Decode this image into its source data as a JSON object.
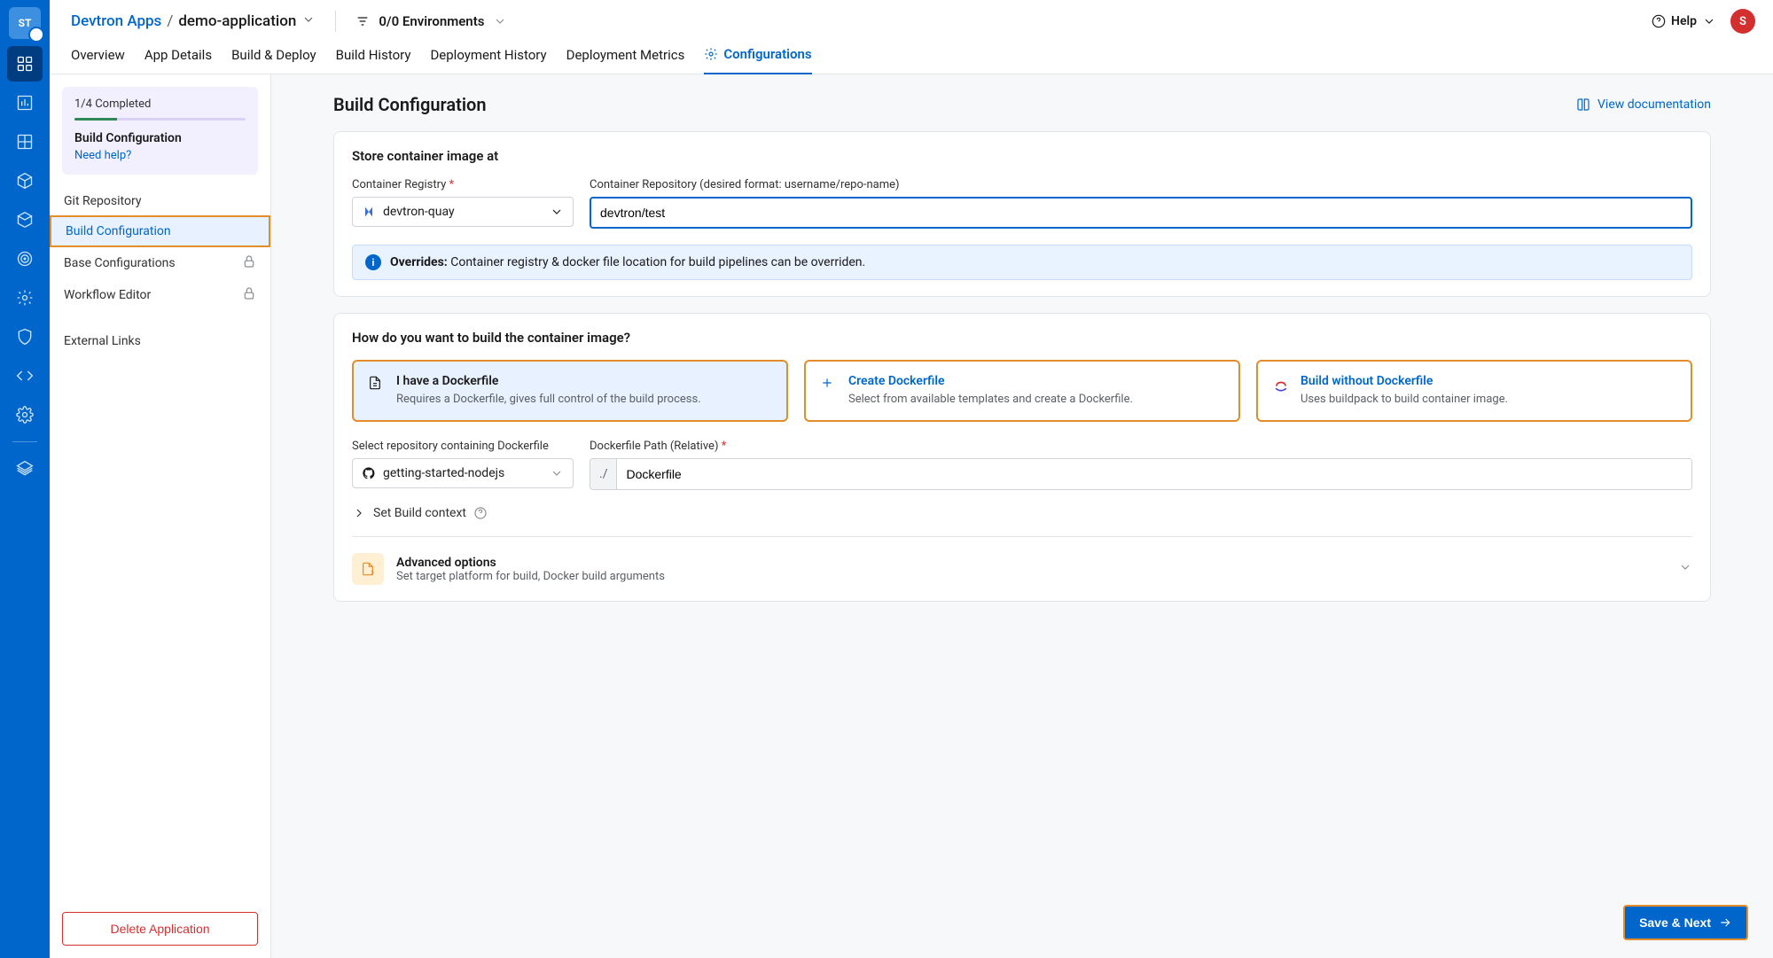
{
  "breadcrumb": {
    "root": "Devtron Apps",
    "current": "demo-application"
  },
  "env_selector": "0/0 Environments",
  "help_label": "Help",
  "avatar_initial": "S",
  "tabs": {
    "overview": "Overview",
    "app_details": "App Details",
    "build_deploy": "Build & Deploy",
    "build_history": "Build History",
    "deploy_history": "Deployment History",
    "deploy_metrics": "Deployment Metrics",
    "configurations": "Configurations"
  },
  "sidebar": {
    "progress": "1/4 Completed",
    "title": "Build Configuration",
    "help": "Need help?",
    "items": {
      "git": "Git Repository",
      "build": "Build Configuration",
      "base": "Base Configurations",
      "workflow": "Workflow Editor",
      "external": "External Links"
    },
    "delete": "Delete Application"
  },
  "page": {
    "title": "Build Configuration",
    "doc_link": "View documentation"
  },
  "store": {
    "heading": "Store container image at",
    "registry_label": "Container Registry",
    "registry_value": "devtron-quay",
    "repo_label": "Container Repository (desired format: username/repo-name)",
    "repo_value": "devtron/test",
    "override_bold": "Overrides:",
    "override_text": " Container registry & docker file location for build pipelines can be overriden."
  },
  "build": {
    "heading": "How do you want to build the container image?",
    "opt1_title": "I have a Dockerfile",
    "opt1_desc": "Requires a Dockerfile, gives full control of the build process.",
    "opt2_title": "Create Dockerfile",
    "opt2_desc": "Select from available templates and create a Dockerfile.",
    "opt3_title": "Build without Dockerfile",
    "opt3_desc": "Uses buildpack to build container image.",
    "repo_label": "Select repository containing Dockerfile",
    "repo_value": "getting-started-nodejs",
    "path_label": "Dockerfile Path (Relative)",
    "path_prefix": "./",
    "path_value": "Dockerfile",
    "context": "Set Build context",
    "adv_title": "Advanced options",
    "adv_desc": "Set target platform for build, Docker build arguments"
  },
  "save_btn": "Save & Next"
}
